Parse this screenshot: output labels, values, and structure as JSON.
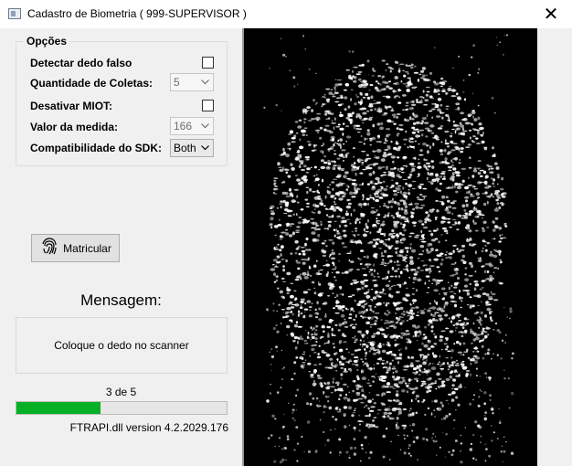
{
  "window": {
    "title": "Cadastro de Biometria ( 999-SUPERVISOR )",
    "close_glyph": "✕"
  },
  "options": {
    "legend": "Opções",
    "detect_fake_label": "Detectar dedo falso",
    "detect_fake_checked": false,
    "capture_count_label": "Quantidade de Coletas:",
    "capture_count_value": "5",
    "disable_miot_label": "Desativar MIOT:",
    "disable_miot_checked": false,
    "measure_label": "Valor da medida:",
    "measure_value": "166",
    "sdk_label": "Compatibilidade do SDK:",
    "sdk_value": "Both"
  },
  "actions": {
    "enroll_label": "Matricular",
    "enroll_icon": "fingerprint-icon"
  },
  "message": {
    "title": "Mensagem:",
    "text": "Coloque o dedo no scanner"
  },
  "progress": {
    "count_text": "3 de 5",
    "fraction": 0.4,
    "color": "#06b025"
  },
  "footer": {
    "version_text": "FTRAPI.dll version 4.2.2029.176"
  }
}
